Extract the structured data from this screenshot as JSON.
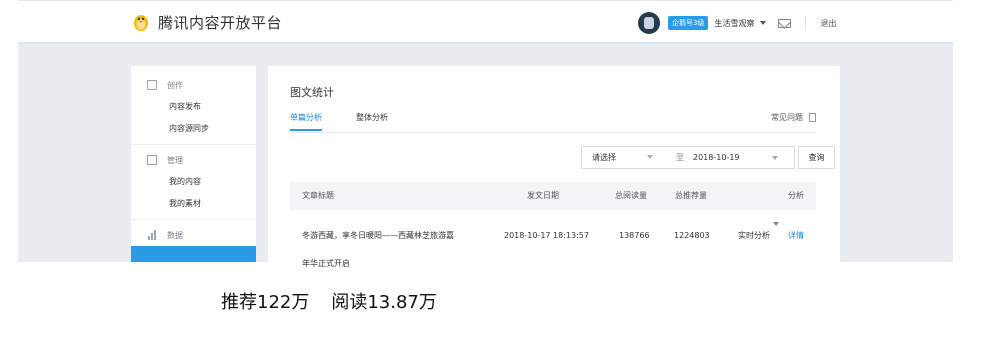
{
  "header": {
    "brand": "腾讯内容开放平台",
    "level_badge": "企鹅号3级",
    "user_name": "生活雪观察",
    "logout": "退出"
  },
  "sidebar": {
    "groups": [
      {
        "title": "创作",
        "icon": "edit-icon",
        "items": [
          "内容发布",
          "内容源同步"
        ]
      },
      {
        "title": "管理",
        "icon": "document-icon",
        "items": [
          "我的内容",
          "我的素材"
        ]
      },
      {
        "title": "数据",
        "icon": "bar-chart-icon",
        "items": [
          ""
        ]
      }
    ]
  },
  "main": {
    "title": "图文统计",
    "tabs": [
      {
        "label": "单篇分析",
        "active": true
      },
      {
        "label": "整体分析",
        "active": false
      }
    ],
    "faq": "常见问题",
    "filter": {
      "select_placeholder": "请选择",
      "to_label": "至",
      "end_date": "2018-10-19",
      "query_button": "查询"
    },
    "table": {
      "columns": [
        "文章标题",
        "发文日期",
        "总阅读量",
        "总推荐量",
        "分析"
      ],
      "rows": [
        {
          "title_line1": "冬游西藏，享冬日暖阳——西藏林芝旅游嘉",
          "title_line2": "年华正式开启",
          "date": "2018-10-17 18:13:57",
          "reads": "138766",
          "recommends": "1224803",
          "realtime": "实时分析",
          "detail": "详情"
        }
      ]
    }
  },
  "caption": {
    "recommend": "推荐122万",
    "read": "阅读13.87万"
  },
  "colors": {
    "accent": "#2b9be6",
    "background": "#e9edf2"
  }
}
